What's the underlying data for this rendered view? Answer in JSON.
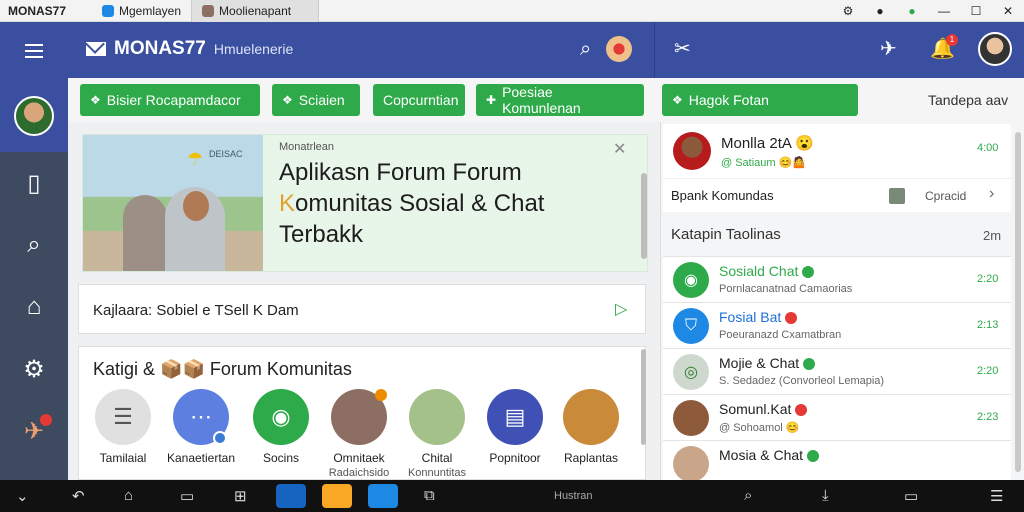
{
  "system_bar": {
    "title": "MONAS77",
    "tabs": [
      {
        "label": "Mgemlayen"
      },
      {
        "label": "Moolienapant"
      }
    ],
    "controls": [
      "minimize",
      "maximize",
      "close"
    ]
  },
  "header": {
    "brand": "MONAS77",
    "subtitle": "Hmuelenerie"
  },
  "chips": [
    {
      "label": "Bisier Rocapamdacor",
      "icon": "chat-bubble-icon"
    },
    {
      "label": "Sciaien",
      "icon": "leaf-icon"
    },
    {
      "label": "Copcurntian",
      "icon": ""
    },
    {
      "label": "Poesiae Komunlenan",
      "icon": "plus-icon"
    },
    {
      "label": "Hagok Fotan",
      "icon": "chat-bubble-icon"
    }
  ],
  "chips_right": "Tandepa  aav",
  "banner": {
    "kicker": "Monatrlean",
    "title_line1": "Aplikasn  Forum Forum",
    "title_hl": "K",
    "title_line2_rest": "omunitas Sosial & Chat",
    "title_line3": "Terbakk",
    "image_caption": "DEISAC"
  },
  "search_card": {
    "text": "Kajlaara: Sobiel e TSell K Dam"
  },
  "categories": {
    "title": "Katigi & 📦📦 Forum Komunitas",
    "items": [
      {
        "label": "Tamilaial",
        "sub": "",
        "color": "#e0e0e0"
      },
      {
        "label": "Kanaetiertan",
        "sub": "",
        "color": "#5c7fe0"
      },
      {
        "label": "Socins",
        "sub": "",
        "color": "#2eaa4a"
      },
      {
        "label": "Omnitaek",
        "sub": "Radaichsido",
        "color": "#8d6e63"
      },
      {
        "label": "Chital",
        "sub": "Konnuntitas",
        "color": "#a5c18a"
      },
      {
        "label": "Popnitoor",
        "sub": "",
        "color": "#3f51b5"
      },
      {
        "label": "Raplantas",
        "sub": "",
        "color": "#c98b3a"
      }
    ]
  },
  "right_panel": {
    "profile": {
      "name": "Monlla 2tA 😮",
      "sub": "@ Satiaum 😊🤷",
      "time": "4:00"
    },
    "group": {
      "text": "Bpank Komundas",
      "status": "Cpracid"
    },
    "section_title": "Katapin Taolinas",
    "section_right": "2m",
    "chats": [
      {
        "name": "Sosiald Chat",
        "sub": "Pornlacanatnad Camaorias",
        "time": "2:20",
        "style": "green",
        "avatar": "#2eaa4a",
        "dot": "#2eaa4a"
      },
      {
        "name": "Fosial Bat",
        "sub": "Poeuranazd Cxamatbran",
        "time": "2:13",
        "style": "blue",
        "avatar": "#1e88e5",
        "dot": "#e53935"
      },
      {
        "name": "Mojie & Chat",
        "sub": "S. Sedadez (Convorleol Lemapia)",
        "time": "2:20",
        "style": "",
        "avatar": "#cfd8cf",
        "dot": "#2eaa4a"
      },
      {
        "name": "Somunl.Kat",
        "sub": "@ Sohoamol 😊",
        "time": "2:23",
        "style": "",
        "avatar": "#8d5a3c",
        "dot": "#e53935"
      },
      {
        "name": "Mosia & Chat",
        "sub": "",
        "time": "",
        "style": "",
        "avatar": "#c9a68a",
        "dot": "#2eaa4a"
      }
    ]
  },
  "taskbar": {
    "center_label": "Hustran"
  }
}
